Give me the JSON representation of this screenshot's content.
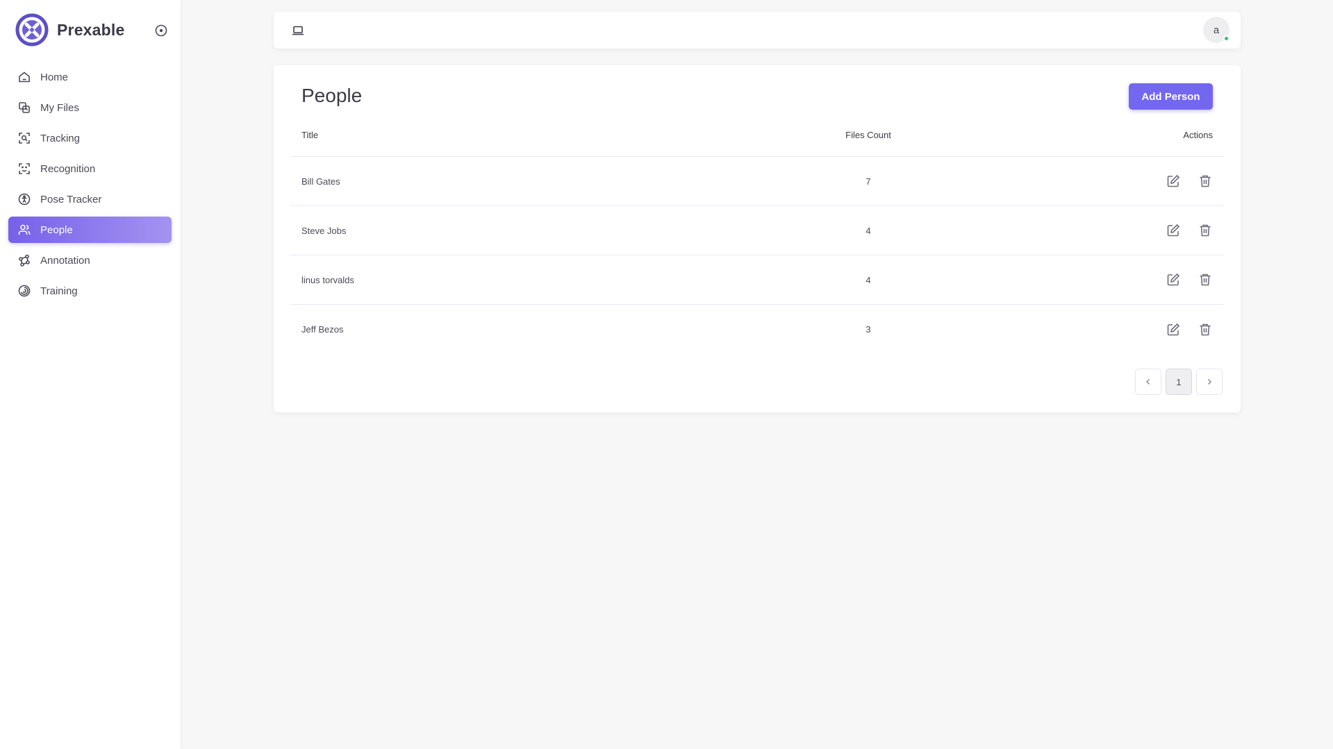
{
  "brand": {
    "name": "Prexable"
  },
  "sidebar": {
    "items": [
      {
        "label": "Home",
        "icon": "home-icon"
      },
      {
        "label": "My Files",
        "icon": "files-icon"
      },
      {
        "label": "Tracking",
        "icon": "tracking-icon"
      },
      {
        "label": "Recognition",
        "icon": "recognition-icon"
      },
      {
        "label": "Pose Tracker",
        "icon": "pose-icon"
      },
      {
        "label": "People",
        "icon": "people-icon",
        "active": true
      },
      {
        "label": "Annotation",
        "icon": "annotation-icon"
      },
      {
        "label": "Training",
        "icon": "training-icon"
      }
    ]
  },
  "topbar": {
    "avatar_initial": "a",
    "status_color": "#28c76f"
  },
  "page": {
    "title": "People",
    "add_button": "Add Person"
  },
  "table": {
    "columns": [
      "Title",
      "Files Count",
      "Actions"
    ],
    "rows": [
      {
        "title": "Bill Gates",
        "count": "7"
      },
      {
        "title": "Steve Jobs",
        "count": "4"
      },
      {
        "title": "linus torvalds",
        "count": "4"
      },
      {
        "title": "Jeff Bezos",
        "count": "3"
      }
    ]
  },
  "pagination": {
    "current_page": "1",
    "prev": "‹",
    "next": "›"
  },
  "colors": {
    "accent": "#7367f0",
    "status": "#28c76f"
  }
}
